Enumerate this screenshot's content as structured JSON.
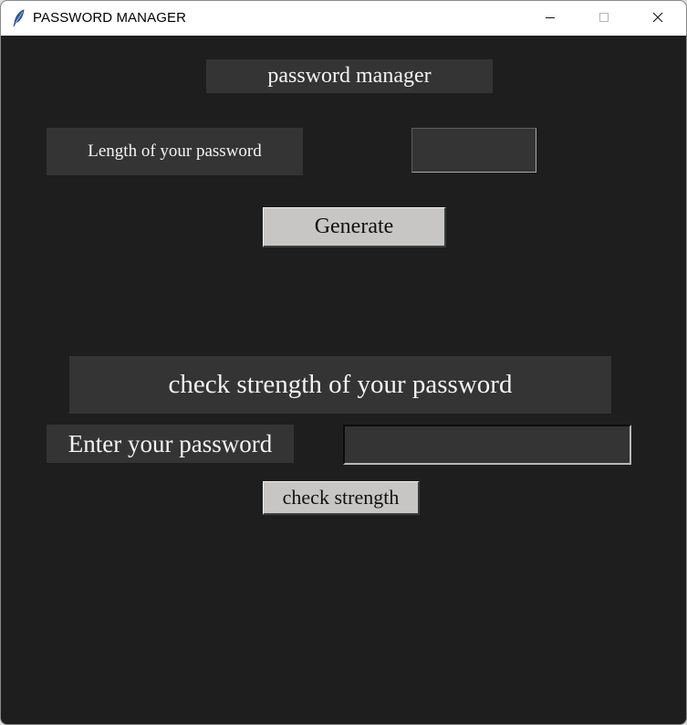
{
  "window": {
    "title": "PASSWORD MANAGER",
    "icon": "feather-icon",
    "controls": [
      "minimize-icon",
      "maximize-icon",
      "close-icon"
    ]
  },
  "header": {
    "title": "password manager"
  },
  "generator": {
    "length_label": "Length of your password",
    "length_value": "",
    "generate_button": "Generate"
  },
  "checker": {
    "section_title": "check strength of your password",
    "password_label": "Enter your password",
    "password_value": "",
    "check_button": "check strength"
  },
  "colors": {
    "background": "#1f1e1f",
    "label_bg": "#343434",
    "label_text": "#f4f4f4",
    "button_bg": "#c8c6c4"
  }
}
